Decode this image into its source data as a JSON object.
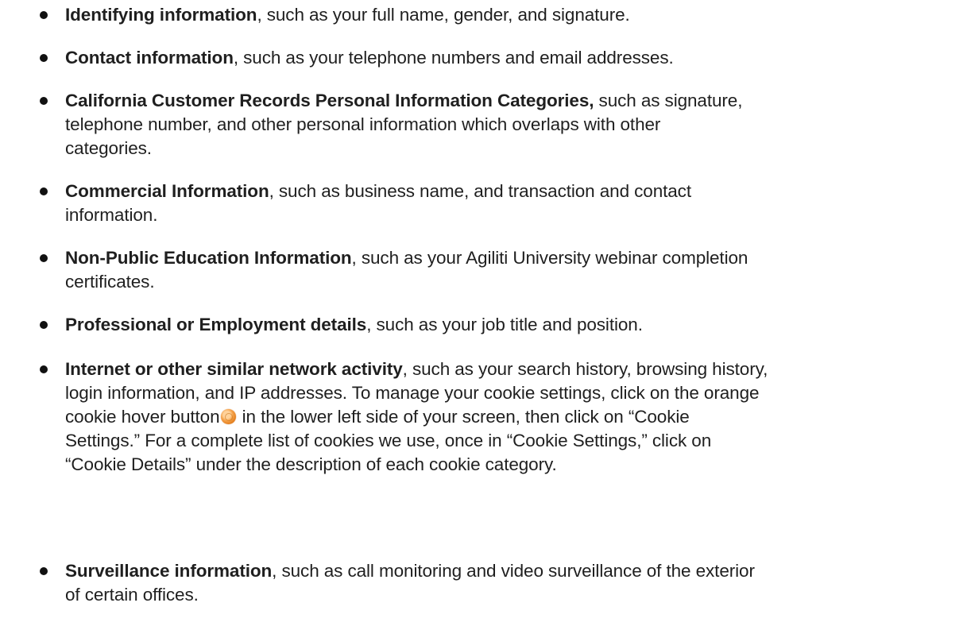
{
  "items": [
    {
      "bold": "Identifying information",
      "rest": ", such as your full name, gender, and signature."
    },
    {
      "bold": "Contact information",
      "rest": ", such as your telephone numbers and email addresses."
    },
    {
      "bold": "California Customer Records Personal Information Categories,",
      "line1": " such as signature,",
      "line2": "telephone number, and other personal information which overlaps with other",
      "line3": "categories."
    },
    {
      "bold": "Commercial Information",
      "line1": ", such as business name, and transaction and contact",
      "line2": "information."
    },
    {
      "bold": "Non-Public Education Information",
      "line1": ", such as your Agiliti University webinar completion",
      "line2": "certificates."
    },
    {
      "bold": "Professional or Employment details",
      "rest": ", such as your job title and position."
    },
    {
      "bold": "Internet or other similar network activity",
      "line1": ", such as your search history, browsing history,",
      "line2": "login information, and IP addresses. To manage your cookie settings, click on the orange",
      "line3a": "cookie hover button",
      "line3b": " in the lower left side of your screen, then click on “Cookie",
      "line4": "Settings.”  For a complete list of cookies we use, once in “Cookie Settings,” click on",
      "line5": "“Cookie Details” under the description of each cookie category."
    },
    {
      "bold": "Surveillance information",
      "line1": ", such as call monitoring and video surveillance of the exterior",
      "line2": "of certain offices."
    }
  ],
  "icons": {
    "cookie": "cookie-hover-button-icon",
    "cookie_color": "#e8892a"
  }
}
